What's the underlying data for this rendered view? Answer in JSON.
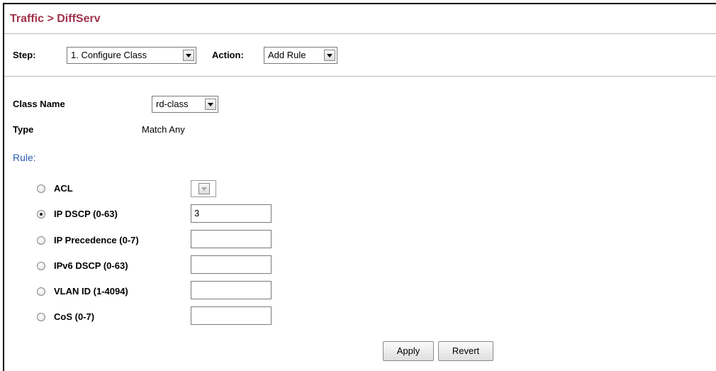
{
  "title": "Traffic > DiffServ",
  "step_bar": {
    "step_label": "Step:",
    "step_value": "1. Configure Class",
    "action_label": "Action:",
    "action_value": "Add Rule"
  },
  "class": {
    "name_label": "Class Name",
    "name_value": "rd-class",
    "type_label": "Type",
    "type_value": "Match Any"
  },
  "rule": {
    "title": "Rule:",
    "items": [
      {
        "label": "ACL",
        "selected": false,
        "value": ""
      },
      {
        "label": "IP DSCP (0-63)",
        "selected": true,
        "value": "3"
      },
      {
        "label": "IP Precedence (0-7)",
        "selected": false,
        "value": ""
      },
      {
        "label": "IPv6 DSCP (0-63)",
        "selected": false,
        "value": ""
      },
      {
        "label": "VLAN ID (1-4094)",
        "selected": false,
        "value": ""
      },
      {
        "label": "CoS (0-7)",
        "selected": false,
        "value": ""
      }
    ]
  },
  "buttons": {
    "apply": "Apply",
    "revert": "Revert"
  }
}
